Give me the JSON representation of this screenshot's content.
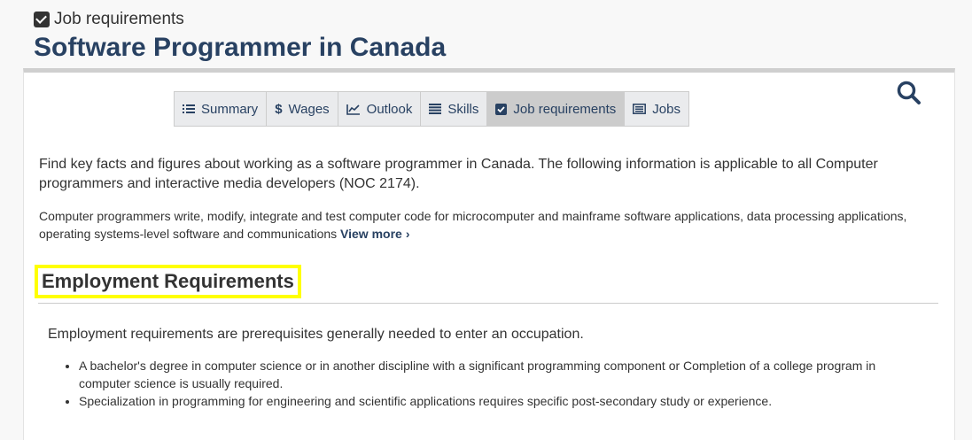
{
  "header": {
    "eyebrow": "Job requirements",
    "title": "Software Programmer in Canada"
  },
  "tabs": [
    {
      "label": "Summary",
      "icon": "list-icon",
      "active": false
    },
    {
      "label": "Wages",
      "icon": "dollar-icon",
      "active": false
    },
    {
      "label": "Outlook",
      "icon": "line-chart-icon",
      "active": false
    },
    {
      "label": "Skills",
      "icon": "bars-icon",
      "active": false
    },
    {
      "label": "Job requirements",
      "icon": "checkbox-icon",
      "active": true
    },
    {
      "label": "Jobs",
      "icon": "newspaper-icon",
      "active": false
    }
  ],
  "intro": "Find key facts and figures about working as a software programmer in Canada. The following information is applicable to all Computer programmers and interactive media developers (NOC 2174).",
  "description": "Computer programmers write, modify, integrate and test computer code for microcomputer and mainframe software applications, data processing applications, operating systems-level software and communications",
  "view_more": "View more",
  "section": {
    "heading": "Employment Requirements",
    "lead": "Employment requirements are prerequisites generally needed to enter an occupation.",
    "items": [
      "A bachelor's degree in computer science or in another discipline with a significant programming component or Completion of a college program in computer science is usually required.",
      "Specialization in programming for engineering and scientific applications requires specific post-secondary study or experience."
    ]
  },
  "colors": {
    "title": "#284162",
    "highlight": "#ffff00",
    "active_tab": "#cccccc"
  }
}
